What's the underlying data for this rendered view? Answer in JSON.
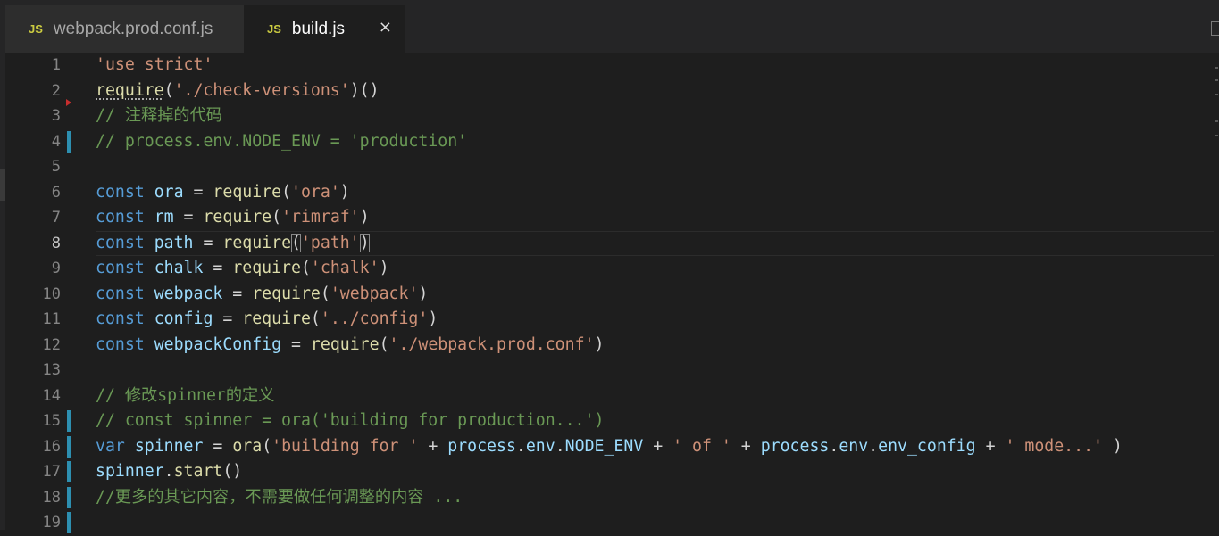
{
  "tabs": [
    {
      "badge": "JS",
      "label": "webpack.prod.conf.js",
      "active": false
    },
    {
      "badge": "JS",
      "label": "build.js",
      "active": true,
      "close": "×"
    }
  ],
  "editor": {
    "current_line": 8,
    "modified_lines": [
      4,
      15,
      16,
      17,
      18,
      19
    ],
    "lines": [
      {
        "n": "1",
        "tokens": [
          [
            "str",
            "'use strict'"
          ]
        ]
      },
      {
        "n": "2",
        "tokens": [
          [
            "fn",
            "require"
          ],
          [
            "pl",
            "("
          ],
          [
            "str",
            "'./check-versions'"
          ],
          [
            "pl",
            ")()"
          ]
        ]
      },
      {
        "n": "3",
        "tokens": [
          [
            "cm",
            "// 注释掉的代码"
          ]
        ]
      },
      {
        "n": "4",
        "tokens": [
          [
            "cm",
            "// process.env.NODE_ENV = 'production'"
          ]
        ]
      },
      {
        "n": "5",
        "tokens": []
      },
      {
        "n": "6",
        "tokens": [
          [
            "kw",
            "const "
          ],
          [
            "var",
            "ora"
          ],
          [
            "pl",
            " = "
          ],
          [
            "fn",
            "require"
          ],
          [
            "pl",
            "("
          ],
          [
            "str",
            "'ora'"
          ],
          [
            "pl",
            ")"
          ]
        ]
      },
      {
        "n": "7",
        "tokens": [
          [
            "kw",
            "const "
          ],
          [
            "var",
            "rm"
          ],
          [
            "pl",
            " = "
          ],
          [
            "fn",
            "require"
          ],
          [
            "pl",
            "("
          ],
          [
            "str",
            "'rimraf'"
          ],
          [
            "pl",
            ")"
          ]
        ]
      },
      {
        "n": "8",
        "tokens": [
          [
            "kw",
            "const "
          ],
          [
            "var",
            "path"
          ],
          [
            "pl",
            " = "
          ],
          [
            "fn",
            "require"
          ],
          [
            "pl",
            "("
          ],
          [
            "str",
            "'path'"
          ],
          [
            "pl",
            ")"
          ]
        ]
      },
      {
        "n": "9",
        "tokens": [
          [
            "kw",
            "const "
          ],
          [
            "var",
            "chalk"
          ],
          [
            "pl",
            " = "
          ],
          [
            "fn",
            "require"
          ],
          [
            "pl",
            "("
          ],
          [
            "str",
            "'chalk'"
          ],
          [
            "pl",
            ")"
          ]
        ]
      },
      {
        "n": "10",
        "tokens": [
          [
            "kw",
            "const "
          ],
          [
            "var",
            "webpack"
          ],
          [
            "pl",
            " = "
          ],
          [
            "fn",
            "require"
          ],
          [
            "pl",
            "("
          ],
          [
            "str",
            "'webpack'"
          ],
          [
            "pl",
            ")"
          ]
        ]
      },
      {
        "n": "11",
        "tokens": [
          [
            "kw",
            "const "
          ],
          [
            "var",
            "config"
          ],
          [
            "pl",
            " = "
          ],
          [
            "fn",
            "require"
          ],
          [
            "pl",
            "("
          ],
          [
            "str",
            "'../config'"
          ],
          [
            "pl",
            ")"
          ]
        ]
      },
      {
        "n": "12",
        "tokens": [
          [
            "kw",
            "const "
          ],
          [
            "var",
            "webpackConfig"
          ],
          [
            "pl",
            " = "
          ],
          [
            "fn",
            "require"
          ],
          [
            "pl",
            "("
          ],
          [
            "str",
            "'./webpack.prod.conf'"
          ],
          [
            "pl",
            ")"
          ]
        ]
      },
      {
        "n": "13",
        "tokens": []
      },
      {
        "n": "14",
        "tokens": [
          [
            "cm",
            "// 修改spinner的定义"
          ]
        ]
      },
      {
        "n": "15",
        "tokens": [
          [
            "cm",
            "// const spinner = ora('building for production...')"
          ]
        ]
      },
      {
        "n": "16",
        "tokens": [
          [
            "kw",
            "var "
          ],
          [
            "var",
            "spinner"
          ],
          [
            "pl",
            " = "
          ],
          [
            "fn",
            "ora"
          ],
          [
            "pl",
            "("
          ],
          [
            "str",
            "'building for '"
          ],
          [
            "pl",
            " + "
          ],
          [
            "var",
            "process"
          ],
          [
            "pl",
            "."
          ],
          [
            "var",
            "env"
          ],
          [
            "pl",
            "."
          ],
          [
            "var",
            "NODE_ENV"
          ],
          [
            "pl",
            " + "
          ],
          [
            "str",
            "' of '"
          ],
          [
            "pl",
            " + "
          ],
          [
            "var",
            "process"
          ],
          [
            "pl",
            "."
          ],
          [
            "var",
            "env"
          ],
          [
            "pl",
            "."
          ],
          [
            "var",
            "env_config"
          ],
          [
            "pl",
            " + "
          ],
          [
            "str",
            "' mode...'"
          ],
          [
            "pl",
            " )"
          ]
        ]
      },
      {
        "n": "17",
        "tokens": [
          [
            "var",
            "spinner"
          ],
          [
            "pl",
            "."
          ],
          [
            "fn",
            "start"
          ],
          [
            "pl",
            "()"
          ]
        ]
      },
      {
        "n": "18",
        "tokens": [
          [
            "cm",
            "//更多的其它内容，不需要做任何调整的内容 ..."
          ]
        ]
      },
      {
        "n": "19",
        "tokens": []
      }
    ]
  },
  "colors": {
    "keyword": "#569cd6",
    "string": "#ce9178",
    "comment": "#6a9955",
    "function": "#dcdcaa",
    "variable": "#9cdcfe",
    "plain": "#d4d4d4",
    "modified_bar": "#2d8fb0",
    "js_badge": "#cbcb41"
  }
}
